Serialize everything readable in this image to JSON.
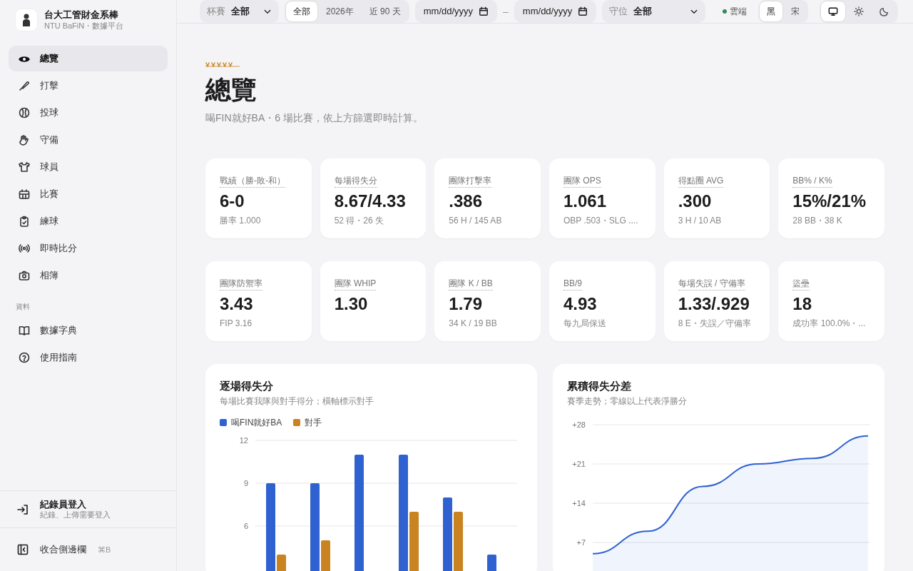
{
  "brand": {
    "title": "台大工管財金系棒",
    "subtitle": "NTU BaFiN・數據平台"
  },
  "nav": [
    {
      "label": "總覽",
      "selected": true
    },
    {
      "label": "打擊",
      "selected": false
    },
    {
      "label": "投球",
      "selected": false
    },
    {
      "label": "守備",
      "selected": false
    },
    {
      "label": "球員",
      "selected": false
    },
    {
      "label": "比賽",
      "selected": false
    },
    {
      "label": "練球",
      "selected": false
    },
    {
      "label": "即時比分",
      "selected": false
    },
    {
      "label": "相簿",
      "selected": false
    }
  ],
  "nav_section": {
    "title": "資料",
    "items": [
      {
        "label": "數據字典",
        "selected": false
      },
      {
        "label": "使用指南",
        "selected": false
      }
    ]
  },
  "login": {
    "title": "紀錄員登入",
    "subtitle": "紀錄、上傳需要登入"
  },
  "collapse": {
    "label": "收合側邊欄",
    "shortcut": "⌘B"
  },
  "toolbar": {
    "cup": {
      "label": "杯賽",
      "value": "全部"
    },
    "ranges": [
      {
        "label": "全部",
        "selected": true
      },
      {
        "label": "2026年",
        "selected": false
      },
      {
        "label": "近 90 天",
        "selected": false
      }
    ],
    "date_from": {
      "placeholder": "mm/dd/yyyy"
    },
    "separator": "–",
    "date_to": {
      "placeholder": "mm/dd/yyyy"
    },
    "position": {
      "label": "守位",
      "value": "全部"
    },
    "sync": {
      "label": "雲端",
      "color": "#2e8b57"
    },
    "fonts": [
      {
        "label": "黑",
        "selected": true
      },
      {
        "label": "宋",
        "selected": false
      }
    ],
    "themes": [
      {
        "kind": "system",
        "selected": true
      },
      {
        "kind": "light",
        "selected": false
      },
      {
        "kind": "dark",
        "selected": false
      }
    ]
  },
  "page": {
    "title": "總覽",
    "subtitle": "喝FIN就好BA・6 場比賽，依上方篩選即時計算。"
  },
  "stats": [
    [
      {
        "label": "戰績（勝-敗-和）",
        "value": "6-0",
        "note": "勝率 1.000"
      },
      {
        "label": "每場得失分",
        "value": "8.67/4.33",
        "note": "52 得・26 失"
      },
      {
        "label": "團隊打擊率",
        "value": ".386",
        "note": "56 H / 145 AB"
      },
      {
        "label": "團隊 OPS",
        "value": "1.061",
        "note": "OBP .503・SLG ...."
      },
      {
        "label": "得點圈 AVG",
        "value": ".300",
        "note": "3 H / 10 AB"
      },
      {
        "label": "BB% / K%",
        "value": "15%/21%",
        "note": "28 BB・38 K"
      }
    ],
    [
      {
        "label": "團隊防禦率",
        "value": "3.43",
        "note": "FIP 3.16"
      },
      {
        "label": "團隊 WHIP",
        "value": "1.30"
      },
      {
        "label": "團隊 K / BB",
        "value": "1.79",
        "note": "34 K / 19 BB"
      },
      {
        "label": "BB/9",
        "value": "4.93",
        "note": "每九局保送"
      },
      {
        "label": "每場失誤 / 守備率",
        "value": "1.33/.929",
        "note": "8 E・失誤／守備率"
      },
      {
        "label": "盜壘",
        "value": "18",
        "note": "成功率 100.0%・..."
      }
    ]
  ],
  "charts": [
    {
      "title": "逐場得失分",
      "subtitle": "每場比賽我隊與對手得分；橫軸標示對手",
      "chart_data": {
        "type": "bar",
        "grid": true,
        "series": [
          {
            "name": "喝FIN就好BA",
            "color": "#2f62d0",
            "values": [
              9,
              9,
              11,
              11,
              8,
              4
            ]
          },
          {
            "name": "對手",
            "color": "#c98320",
            "values": [
              4,
              5,
              null,
              7,
              7,
              null
            ]
          }
        ],
        "ylim": [
          0,
          12
        ],
        "yticks": [
          6,
          9,
          12
        ]
      }
    },
    {
      "title": "累積得失分差",
      "subtitle": "賽季走勢；零線以上代表淨勝分",
      "chart_data": {
        "type": "area",
        "grid": true,
        "series": [
          {
            "color": "#2f62d0",
            "values": [
              5,
              9,
              17,
              21,
              22,
              26
            ]
          }
        ],
        "ylim": [
          0,
          28
        ],
        "yticks": [
          {
            "value": 7,
            "label": "+7"
          },
          {
            "value": 14,
            "label": "+14"
          },
          {
            "value": 21,
            "label": "+21"
          },
          {
            "value": 28,
            "label": "+28"
          }
        ]
      }
    }
  ]
}
